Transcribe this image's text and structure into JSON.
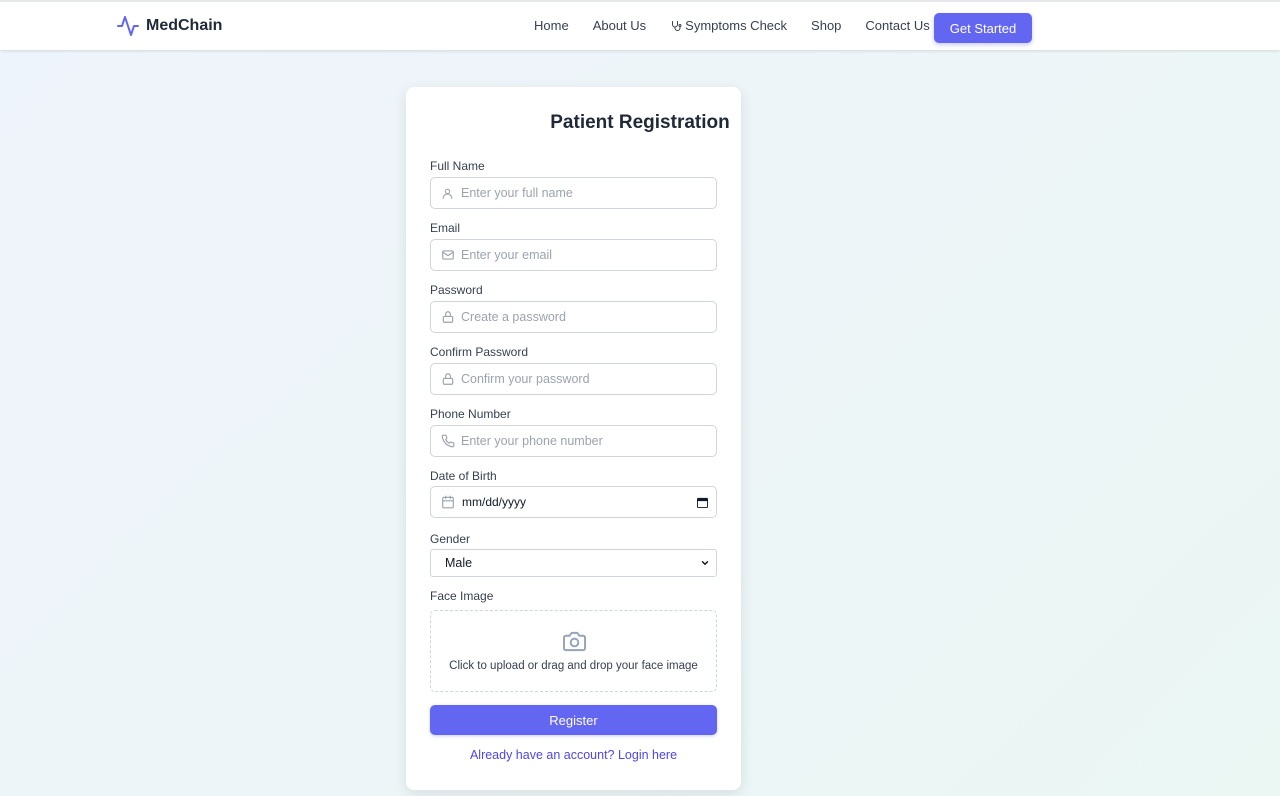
{
  "nav": {
    "brand": "MedChain",
    "links": [
      {
        "label": "Home"
      },
      {
        "label": "About Us"
      },
      {
        "label": "Symptoms Check"
      },
      {
        "label": "Shop"
      },
      {
        "label": "Contact Us"
      }
    ],
    "cta_label": "Get Started",
    "icons": {
      "brand": "activity-pulse-icon",
      "symptoms": "stethoscope-icon"
    }
  },
  "form": {
    "title": "Patient Registration",
    "full_name": {
      "label": "Full Name",
      "placeholder": "Enter your full name",
      "icon": "user-icon"
    },
    "email": {
      "label": "Email",
      "placeholder": "Enter your email",
      "icon": "mail-icon"
    },
    "password": {
      "label": "Password",
      "placeholder": "Create a password",
      "icon": "lock-icon"
    },
    "confirm_password": {
      "label": "Confirm Password",
      "placeholder": "Confirm your password",
      "icon": "lock-icon"
    },
    "phone": {
      "label": "Phone Number",
      "placeholder": "Enter your phone number",
      "icon": "phone-icon"
    },
    "dob": {
      "label": "Date of Birth",
      "value": "mm/dd/yyyy",
      "icon": "calendar-icon"
    },
    "gender": {
      "label": "Gender",
      "selected": "Male"
    },
    "face_image": {
      "label": "Face Image",
      "hint": "Click to upload or drag and drop your face image",
      "icon": "camera-icon"
    },
    "submit_label": "Register",
    "login_text": "Already have an account? Login here"
  },
  "colors": {
    "accent": "#6366f1",
    "link": "#4f46e5",
    "text": "#1f2937",
    "muted": "#9ca3af",
    "border": "#d1d5db"
  }
}
